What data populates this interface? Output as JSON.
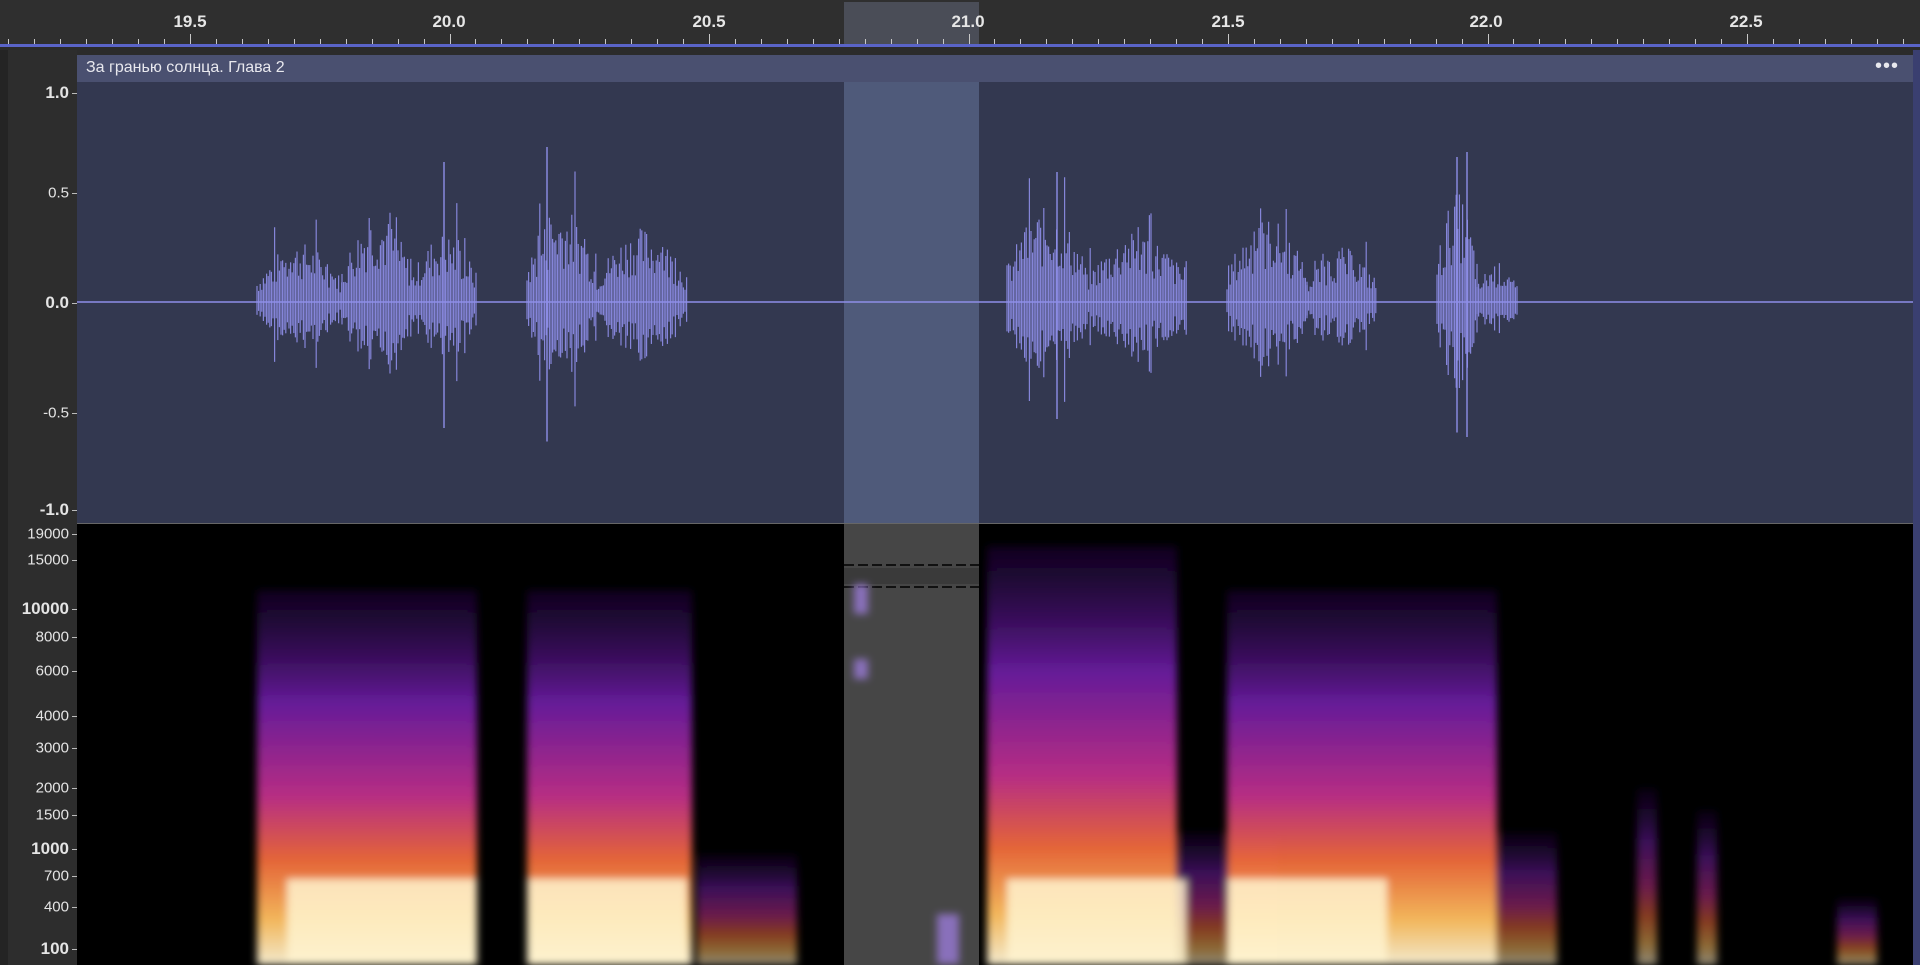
{
  "timeline": {
    "ticks": [
      "19.5",
      "20.0",
      "20.5",
      "21.0",
      "21.5",
      "22.0",
      "22.5"
    ],
    "selection_start": 20.78,
    "selection_end": 21.04
  },
  "track": {
    "title": "За гранью солнца. Глава 2",
    "menu_label": "•••"
  },
  "waveform_scale": [
    "1.0",
    "0.5",
    "0.0",
    "-0.5",
    "-1.0"
  ],
  "spectrogram_scale": [
    "19000",
    "15000",
    "10000",
    "8000",
    "6000",
    "4000",
    "3000",
    "2000",
    "1500",
    "1000",
    "700",
    "400",
    "100"
  ],
  "colors": {
    "waveform": "#8e8ee8",
    "waveform_bg": "#333850",
    "selection_wave": "#4f5a7a",
    "spectrogram_selection": "#4a4a4a",
    "ruler_accent": "#5a64c8"
  }
}
